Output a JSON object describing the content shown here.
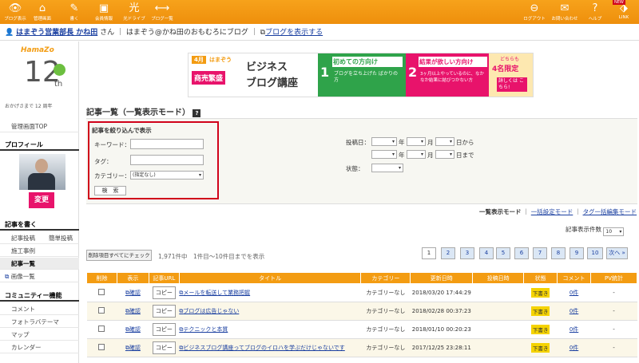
{
  "topbar": {
    "items": [
      {
        "label": "ブログ表示",
        "icon": "eye-icon"
      },
      {
        "label": "管理画面",
        "icon": "home-icon"
      },
      {
        "label": "書く",
        "icon": "pencil-icon"
      },
      {
        "label": "会員情報",
        "icon": "user-card-icon"
      },
      {
        "label": "光ドライブ",
        "icon": "drive-icon"
      },
      {
        "label": "ブログ一覧",
        "icon": "arrows-icon"
      }
    ],
    "right_items": [
      {
        "label": "ログアウト",
        "icon": "logout-icon"
      },
      {
        "label": "お問い合わせ",
        "icon": "mail-icon"
      },
      {
        "label": "ヘルプ",
        "icon": "help-icon"
      },
      {
        "label": "LINK",
        "badge": "NEW",
        "icon": "link-icon"
      }
    ]
  },
  "userbar": {
    "name": "はまぞう営業部長 かね田",
    "suffix": "さん",
    "blog": "はまぞう@かね田のおもむろにブログ",
    "view_link": "ブログを表示する"
  },
  "logo": {
    "brand": "HamaZo",
    "years": "12",
    "th": "th",
    "caption": "おかげさまで 12 周年"
  },
  "sidebar": {
    "top": "管理画面TOP",
    "profile": "プロフィール",
    "change": "変更",
    "write_head": "記事を書く",
    "post": "記事投稿",
    "simple_post": "簡単投稿",
    "works": "施工事例",
    "list": "記事一覧",
    "images": "画像一覧",
    "community": "コミュニティー機能",
    "comment": "コメント",
    "photo": "フォトラバテーマ",
    "map": "マップ",
    "calendar": "カレンダー"
  },
  "banner": {
    "month": "4月",
    "brand": "はまぞう",
    "tag": "商売繁盛",
    "title1": "ビジネス",
    "title2": "ブログ講座",
    "box1_num": "1",
    "box1": "初めての方向け",
    "box1_sub": "ブログを立ち上げた ばかりの方",
    "box2_num": "2",
    "box2": "結果が欲しい方向け",
    "box2_sub": "3ヶ月以上やっているのに、なかなか結果に結びつかない方",
    "limit_pre": "どちらも",
    "limit": "4名限定",
    "more": "詳しくは こちら!"
  },
  "page": {
    "title": "記事一覧（一覧表示モード）",
    "help": "?"
  },
  "filter": {
    "heading": "記事を絞り込んで表示",
    "keyword": "キーワード：",
    "tag": "タグ：",
    "category": "カテゴリー：",
    "category_value": "(指定なし)",
    "search": "検　索",
    "date_label": "投稿日：",
    "year": "年",
    "month": "月",
    "day_from": "日から",
    "day_to": "日まで",
    "status": "状態："
  },
  "modes": {
    "list": "一覧表示モード",
    "bulk": "一括設定モード",
    "tag": "タグ一括編集モード"
  },
  "perpage": {
    "label": "記事表示件数",
    "value": "10"
  },
  "bulk_check": "削除項目すべてにチェック",
  "count": "1,971件中　1件目～10件目までを表示",
  "pages": [
    "1",
    "2",
    "3",
    "4",
    "5",
    "6",
    "7",
    "8",
    "9",
    "10"
  ],
  "next": "次へ »",
  "table": {
    "headers": [
      "削除",
      "表示",
      "記事URL",
      "タイトル",
      "カテゴリー",
      "更新日時",
      "投稿日時",
      "状態",
      "コメント",
      "PV統計"
    ],
    "rows": [
      {
        "view": "確認",
        "copy": "コピー",
        "title": "メールを転送して業務把握",
        "category": "カテゴリーなし",
        "updated": "2018/03/20 17:44:29",
        "posted": "",
        "status": "下書き",
        "comments": "0件",
        "pv": "-"
      },
      {
        "view": "確認",
        "copy": "コピー",
        "title": "ブログは広告じゃない",
        "category": "カテゴリーなし",
        "updated": "2018/02/28 00:37:23",
        "posted": "",
        "status": "下書き",
        "comments": "0件",
        "pv": "-"
      },
      {
        "view": "確認",
        "copy": "コピー",
        "title": "テクニックと本質",
        "category": "カテゴリーなし",
        "updated": "2018/01/10 00:20:23",
        "posted": "",
        "status": "下書き",
        "comments": "0件",
        "pv": "-"
      },
      {
        "view": "確認",
        "copy": "コピー",
        "title": "ビジネスブログ講座ってブログのイロハを学ぶだけじゃないです",
        "category": "カテゴリーなし",
        "updated": "2017/12/25 23:28:11",
        "posted": "",
        "status": "下書き",
        "comments": "0件",
        "pv": "-"
      }
    ]
  }
}
